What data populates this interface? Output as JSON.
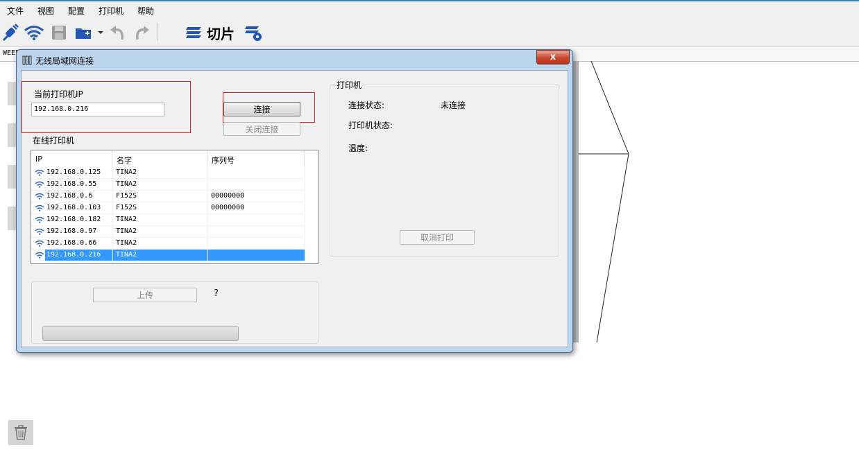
{
  "menu": [
    "文件",
    "视图",
    "配置",
    "打印机",
    "帮助"
  ],
  "toolbar": {
    "icons": [
      "connect-plug-icon",
      "wifi-icon",
      "save-icon",
      "open-folder-icon",
      "undo-icon",
      "redo-icon",
      "slice-layers-icon",
      "slice-settings-icon"
    ],
    "slice_label": "切片"
  },
  "tab_label": "WEEF",
  "dialog": {
    "title": "无线局域网连接",
    "close_symbol": "x",
    "current_ip_label": "当前打印机IP",
    "current_ip_value": "192.168.0.216",
    "connect_button": "连接",
    "disconnect_button": "关闭连接",
    "online_printers_label": "在线打印机",
    "columns": [
      "IP",
      "名字",
      "序列号"
    ],
    "rows": [
      {
        "ip": "192.168.0.125",
        "name": "TINA2",
        "serial": ""
      },
      {
        "ip": "192.168.0.55",
        "name": "TINA2",
        "serial": ""
      },
      {
        "ip": "192.168.0.6",
        "name": "F152S",
        "serial": "00000000"
      },
      {
        "ip": "192.168.0.103",
        "name": "F152S",
        "serial": "00000000"
      },
      {
        "ip": "192.168.0.182",
        "name": "TINA2",
        "serial": ""
      },
      {
        "ip": "192.168.0.97",
        "name": "TINA2",
        "serial": ""
      },
      {
        "ip": "192.168.0.66",
        "name": "TINA2",
        "serial": ""
      },
      {
        "ip": "192.168.0.216",
        "name": "TINA2",
        "serial": "",
        "selected": true
      }
    ],
    "upload_button": "上传",
    "upload_question": "?",
    "printer_group_label": "打印机",
    "connection_status_label": "连接状态:",
    "connection_status_value": "未连接",
    "printer_status_label": "打印机状态:",
    "temperature_label": "温度:",
    "cancel_print_button": "取消打印"
  },
  "colors": {
    "selection": "#3399ff",
    "highlight_box": "#e3282b",
    "toolbar_icon": "#2456b8",
    "dialog_frame": "#bcd6ef"
  }
}
